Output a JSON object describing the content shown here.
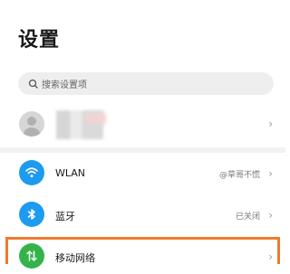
{
  "header": {
    "title": "设置"
  },
  "search": {
    "placeholder": "搜索设置项"
  },
  "account": {
    "chevron": "›"
  },
  "items": [
    {
      "label": "WLAN",
      "value": "@草哥不慌",
      "icon": "wifi-icon",
      "color": "#1d9bf0"
    },
    {
      "label": "蓝牙",
      "value": "已关闭",
      "icon": "bluetooth-icon",
      "color": "#1d9bf0"
    },
    {
      "label": "移动网络",
      "value": "",
      "icon": "mobile-network-icon",
      "color": "#34b34a"
    }
  ],
  "chevron": "›",
  "highlight_color": "#f07a2c"
}
